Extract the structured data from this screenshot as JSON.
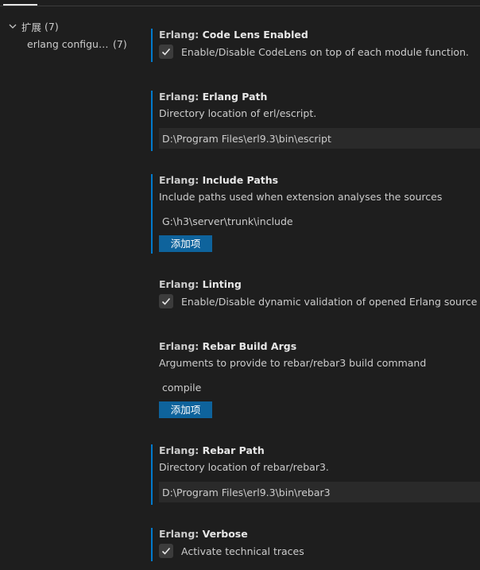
{
  "toc": {
    "group_label": "扩展",
    "group_count": "(7)",
    "child_label": "erlang configura...",
    "child_count": "(7)"
  },
  "settings": {
    "code_lens": {
      "category": "Erlang: ",
      "name": "Code Lens Enabled",
      "checkbox_label": "Enable/Disable CodeLens on top of each module function.",
      "checked": true
    },
    "erlang_path": {
      "category": "Erlang: ",
      "name": "Erlang Path",
      "description": "Directory location of erl/escript.",
      "value": "D:\\Program Files\\erl9.3\\bin\\escript"
    },
    "include_paths": {
      "category": "Erlang: ",
      "name": "Include Paths",
      "description": "Include paths used when extension analyses the sources",
      "items": [
        "G:\\h3\\server\\trunk\\include"
      ],
      "add_label": "添加项"
    },
    "linting": {
      "category": "Erlang: ",
      "name": "Linting",
      "checkbox_label": "Enable/Disable dynamic validation of opened Erlang source files.",
      "checked": true
    },
    "rebar_build_args": {
      "category": "Erlang: ",
      "name": "Rebar Build Args",
      "description": "Arguments to provide to rebar/rebar3 build command",
      "items": [
        "compile"
      ],
      "add_label": "添加项"
    },
    "rebar_path": {
      "category": "Erlang: ",
      "name": "Rebar Path",
      "description": "Directory location of rebar/rebar3.",
      "value": "D:\\Program Files\\erl9.3\\bin\\rebar3"
    },
    "verbose": {
      "category": "Erlang: ",
      "name": "Verbose",
      "checkbox_label": "Activate technical traces",
      "checked": true
    }
  },
  "colors": {
    "background": "#1e1e1e",
    "focus_border": "#007acc",
    "button": "#0e639c",
    "input_bg": "#2a2a2a"
  }
}
